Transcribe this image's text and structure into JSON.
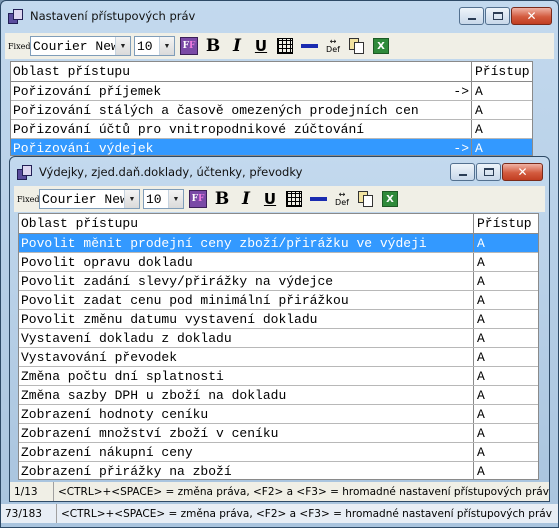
{
  "outer": {
    "title": "Nastavení přístupových práv",
    "toolbar": {
      "fixed_label": "Fixed",
      "font": "Courier New",
      "size": "10",
      "bold": "B",
      "italic": "I",
      "underline": "U",
      "def_label": "Def"
    },
    "columns": [
      "Oblast přístupu",
      "Přístup"
    ],
    "rows": [
      {
        "label": "Pořizování příjemek",
        "pointer": "->",
        "value": "A"
      },
      {
        "label": "Pořizování stálých a časově omezených prodejních cen",
        "pointer": "",
        "value": "A"
      },
      {
        "label": "Pořizování účtů pro vnitropodnikové zúčtování",
        "pointer": "",
        "value": "A"
      },
      {
        "label": "Pořizování výdejek",
        "pointer": "->",
        "value": "A",
        "selected": true
      }
    ],
    "status": {
      "count": "73/183",
      "hint": "<CTRL>+<SPACE> = změna práva, <F2> a <F3> = hromadné nastavení přístupových práv"
    }
  },
  "inner": {
    "title": "Výdejky, zjed.daň.doklady, účtenky, převodky",
    "toolbar": {
      "fixed_label": "Fixed",
      "font": "Courier New",
      "size": "10",
      "bold": "B",
      "italic": "I",
      "underline": "U",
      "def_label": "Def"
    },
    "columns": [
      "Oblast přístupu",
      "Přístup"
    ],
    "rows": [
      {
        "label": "Povolit měnit prodejní ceny zboží/přirážku ve výdeji",
        "value": "A",
        "selected": true
      },
      {
        "label": "Povolit opravu dokladu",
        "value": "A"
      },
      {
        "label": "Povolit zadání slevy/přirážky na výdejce",
        "value": "A"
      },
      {
        "label": "Povolit zadat cenu pod minimální přirážkou",
        "value": "A"
      },
      {
        "label": "Povolit změnu datumu vystavení dokladu",
        "value": "A"
      },
      {
        "label": "Vystavení dokladu z dokladu",
        "value": "A"
      },
      {
        "label": "Vystavování převodek",
        "value": "A"
      },
      {
        "label": "Změna počtu dní splatnosti",
        "value": "A"
      },
      {
        "label": "Změna sazby DPH u zboží na dokladu",
        "value": "A"
      },
      {
        "label": "Zobrazení hodnoty ceníku",
        "value": "A"
      },
      {
        "label": "Zobrazení množství zboží v ceníku",
        "value": "A"
      },
      {
        "label": "Zobrazení nákupní ceny",
        "value": "A"
      },
      {
        "label": "Zobrazení přirážky na zboží",
        "value": "A"
      }
    ],
    "status": {
      "count": "1/13",
      "hint": "<CTRL>+<SPACE> = změna práva, <F2> a <F3> = hromadné nastavení přístupových práv"
    }
  },
  "colors": {
    "selection": "#3399ff",
    "toolbar_bg": "#f0efe6",
    "frame": "#b7cde3"
  }
}
